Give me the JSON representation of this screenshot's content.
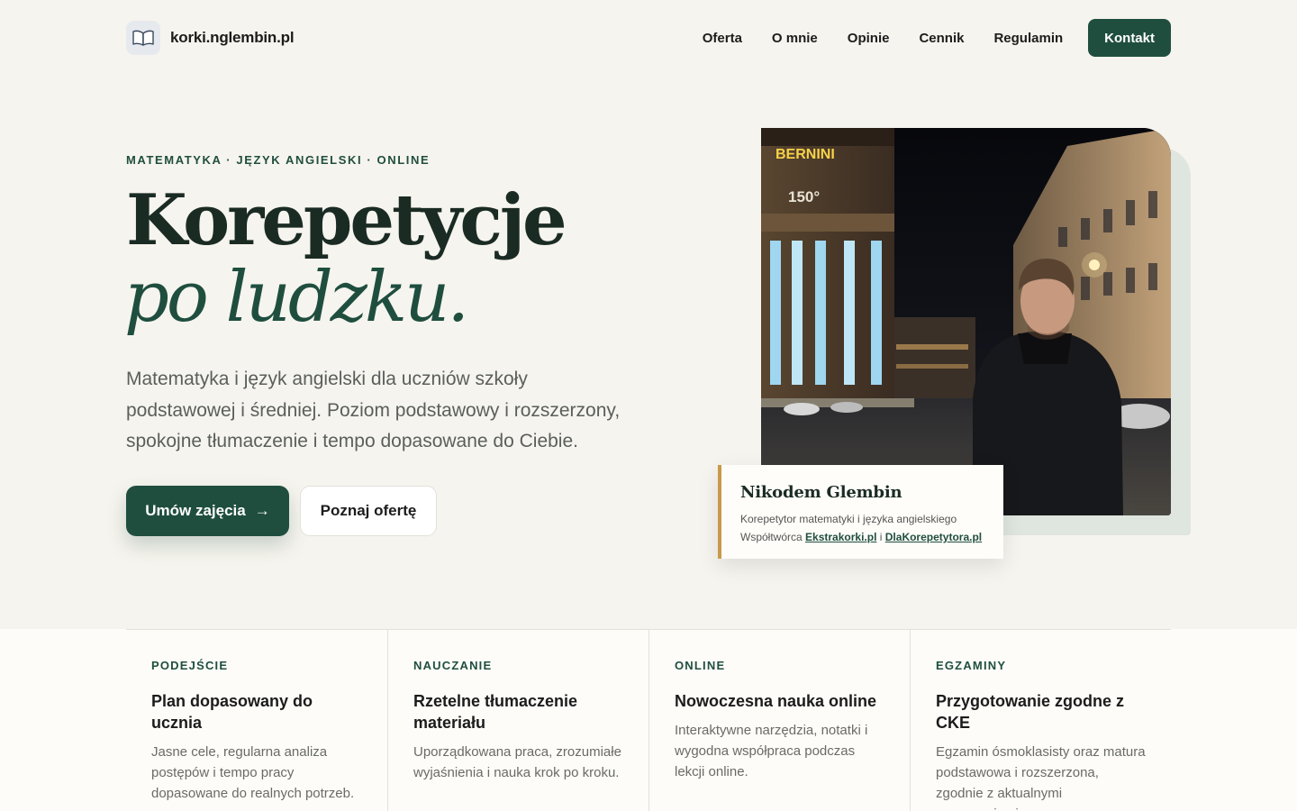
{
  "brand": {
    "name": "korki.nglembin.pl",
    "logo_icon": "open-book-icon"
  },
  "nav": {
    "items": [
      {
        "label": "Oferta"
      },
      {
        "label": "O mnie"
      },
      {
        "label": "Opinie"
      },
      {
        "label": "Cennik"
      },
      {
        "label": "Regulamin"
      }
    ],
    "contact_label": "Kontakt"
  },
  "hero": {
    "eyebrow": "MATEMATYKA · JĘZYK ANGIELSKI · ONLINE",
    "title_line1": "Korepetycje",
    "title_line2": "po ludzku.",
    "description": "Matematyka i język angielski dla uczniów szkoły podstawowej i średniej. Poziom podstawowy i rozszerzony, spokojne tłumaczenie i tempo dopasowane do Ciebie.",
    "primary_cta": "Umów zajęcia",
    "primary_cta_arrow": "→",
    "secondary_cta": "Poznaj ofertę"
  },
  "photo": {
    "sign_text": "BERNINI",
    "sign_number": "150°"
  },
  "profile": {
    "name": "Nikodem Glembin",
    "role": "Korepetytor matematyki i języka angielskiego",
    "collab_prefix": "Współtwórca",
    "link1": "Ekstrakorki.pl",
    "link_joiner": "i",
    "link2": "DlaKorepetytora.pl"
  },
  "features": [
    {
      "tag": "PODEJŚCIE",
      "title": "Plan dopasowany do ucznia",
      "text": "Jasne cele, regularna analiza postępów i tempo pracy dopasowane do realnych potrzeb."
    },
    {
      "tag": "NAUCZANIE",
      "title": "Rzetelne tłumaczenie materiału",
      "text": "Uporządkowana praca, zrozumiałe wyjaśnienia i nauka krok po kroku."
    },
    {
      "tag": "ONLINE",
      "title": "Nowoczesna nauka online",
      "text": "Interaktywne narzędzia, notatki i wygodna współpraca podczas lekcji online."
    },
    {
      "tag": "EGZAMINY",
      "title": "Przygotowanie zgodne z CKE",
      "text": "Egzamin ósmoklasisty oraz matura podstawowa i rozszerzona, zgodnie z aktualnymi wymaganiami."
    }
  ],
  "colors": {
    "accent": "#1f4e3f",
    "background": "#f6f4ee",
    "caption_border": "#c79a4b"
  }
}
